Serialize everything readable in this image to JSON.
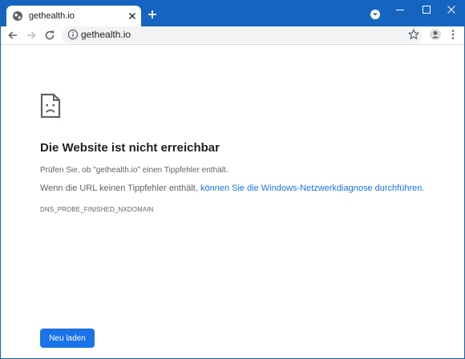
{
  "colors": {
    "titlebar": "#1565c0",
    "accent": "#1a73e8",
    "text": "#202124",
    "muted": "#5f6368"
  },
  "tab": {
    "title": "gethealth.io",
    "favicon": "globe-icon"
  },
  "omnibox": {
    "url": "gethealth.io"
  },
  "error": {
    "heading": "Die Website ist nicht erreichbar",
    "line1": "Prüfen Sie, ob \"gethealth.io\" einen Tippfehler enthält.",
    "line2_prefix": "Wenn die URL keinen Tippfehler enthält, ",
    "line2_link": "können Sie die Windows-Netzwerkdiagnose durchführen",
    "line2_suffix": ".",
    "code": "DNS_PROBE_FINISHED_NXDOMAIN",
    "reload_label": "Neu laden"
  }
}
